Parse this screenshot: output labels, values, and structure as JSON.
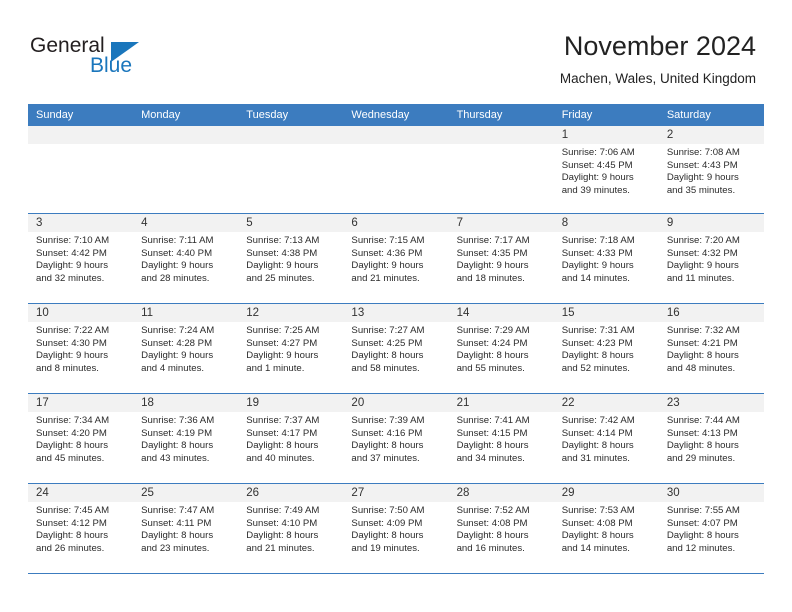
{
  "logo": {
    "word_top": "General",
    "word_bottom": "Blue",
    "accent_color": "#1a76bc"
  },
  "header": {
    "title": "November 2024",
    "subtitle": "Machen, Wales, United Kingdom"
  },
  "calendar": {
    "header_bg": "#3c7cbf",
    "daynum_bg": "#f2f2f2",
    "weekdays": [
      "Sunday",
      "Monday",
      "Tuesday",
      "Wednesday",
      "Thursday",
      "Friday",
      "Saturday"
    ],
    "weeks": [
      [
        {
          "day": "",
          "blank": true,
          "sunrise": "",
          "sunset": "",
          "daylight_1": "",
          "daylight_2": ""
        },
        {
          "day": "",
          "blank": true,
          "sunrise": "",
          "sunset": "",
          "daylight_1": "",
          "daylight_2": ""
        },
        {
          "day": "",
          "blank": true,
          "sunrise": "",
          "sunset": "",
          "daylight_1": "",
          "daylight_2": ""
        },
        {
          "day": "",
          "blank": true,
          "sunrise": "",
          "sunset": "",
          "daylight_1": "",
          "daylight_2": ""
        },
        {
          "day": "",
          "blank": true,
          "sunrise": "",
          "sunset": "",
          "daylight_1": "",
          "daylight_2": ""
        },
        {
          "day": "1",
          "sunrise": "Sunrise: 7:06 AM",
          "sunset": "Sunset: 4:45 PM",
          "daylight_1": "Daylight: 9 hours",
          "daylight_2": "and 39 minutes."
        },
        {
          "day": "2",
          "sunrise": "Sunrise: 7:08 AM",
          "sunset": "Sunset: 4:43 PM",
          "daylight_1": "Daylight: 9 hours",
          "daylight_2": "and 35 minutes."
        }
      ],
      [
        {
          "day": "3",
          "sunrise": "Sunrise: 7:10 AM",
          "sunset": "Sunset: 4:42 PM",
          "daylight_1": "Daylight: 9 hours",
          "daylight_2": "and 32 minutes."
        },
        {
          "day": "4",
          "sunrise": "Sunrise: 7:11 AM",
          "sunset": "Sunset: 4:40 PM",
          "daylight_1": "Daylight: 9 hours",
          "daylight_2": "and 28 minutes."
        },
        {
          "day": "5",
          "sunrise": "Sunrise: 7:13 AM",
          "sunset": "Sunset: 4:38 PM",
          "daylight_1": "Daylight: 9 hours",
          "daylight_2": "and 25 minutes."
        },
        {
          "day": "6",
          "sunrise": "Sunrise: 7:15 AM",
          "sunset": "Sunset: 4:36 PM",
          "daylight_1": "Daylight: 9 hours",
          "daylight_2": "and 21 minutes."
        },
        {
          "day": "7",
          "sunrise": "Sunrise: 7:17 AM",
          "sunset": "Sunset: 4:35 PM",
          "daylight_1": "Daylight: 9 hours",
          "daylight_2": "and 18 minutes."
        },
        {
          "day": "8",
          "sunrise": "Sunrise: 7:18 AM",
          "sunset": "Sunset: 4:33 PM",
          "daylight_1": "Daylight: 9 hours",
          "daylight_2": "and 14 minutes."
        },
        {
          "day": "9",
          "sunrise": "Sunrise: 7:20 AM",
          "sunset": "Sunset: 4:32 PM",
          "daylight_1": "Daylight: 9 hours",
          "daylight_2": "and 11 minutes."
        }
      ],
      [
        {
          "day": "10",
          "sunrise": "Sunrise: 7:22 AM",
          "sunset": "Sunset: 4:30 PM",
          "daylight_1": "Daylight: 9 hours",
          "daylight_2": "and 8 minutes."
        },
        {
          "day": "11",
          "sunrise": "Sunrise: 7:24 AM",
          "sunset": "Sunset: 4:28 PM",
          "daylight_1": "Daylight: 9 hours",
          "daylight_2": "and 4 minutes."
        },
        {
          "day": "12",
          "sunrise": "Sunrise: 7:25 AM",
          "sunset": "Sunset: 4:27 PM",
          "daylight_1": "Daylight: 9 hours",
          "daylight_2": "and 1 minute."
        },
        {
          "day": "13",
          "sunrise": "Sunrise: 7:27 AM",
          "sunset": "Sunset: 4:25 PM",
          "daylight_1": "Daylight: 8 hours",
          "daylight_2": "and 58 minutes."
        },
        {
          "day": "14",
          "sunrise": "Sunrise: 7:29 AM",
          "sunset": "Sunset: 4:24 PM",
          "daylight_1": "Daylight: 8 hours",
          "daylight_2": "and 55 minutes."
        },
        {
          "day": "15",
          "sunrise": "Sunrise: 7:31 AM",
          "sunset": "Sunset: 4:23 PM",
          "daylight_1": "Daylight: 8 hours",
          "daylight_2": "and 52 minutes."
        },
        {
          "day": "16",
          "sunrise": "Sunrise: 7:32 AM",
          "sunset": "Sunset: 4:21 PM",
          "daylight_1": "Daylight: 8 hours",
          "daylight_2": "and 48 minutes."
        }
      ],
      [
        {
          "day": "17",
          "sunrise": "Sunrise: 7:34 AM",
          "sunset": "Sunset: 4:20 PM",
          "daylight_1": "Daylight: 8 hours",
          "daylight_2": "and 45 minutes."
        },
        {
          "day": "18",
          "sunrise": "Sunrise: 7:36 AM",
          "sunset": "Sunset: 4:19 PM",
          "daylight_1": "Daylight: 8 hours",
          "daylight_2": "and 43 minutes."
        },
        {
          "day": "19",
          "sunrise": "Sunrise: 7:37 AM",
          "sunset": "Sunset: 4:17 PM",
          "daylight_1": "Daylight: 8 hours",
          "daylight_2": "and 40 minutes."
        },
        {
          "day": "20",
          "sunrise": "Sunrise: 7:39 AM",
          "sunset": "Sunset: 4:16 PM",
          "daylight_1": "Daylight: 8 hours",
          "daylight_2": "and 37 minutes."
        },
        {
          "day": "21",
          "sunrise": "Sunrise: 7:41 AM",
          "sunset": "Sunset: 4:15 PM",
          "daylight_1": "Daylight: 8 hours",
          "daylight_2": "and 34 minutes."
        },
        {
          "day": "22",
          "sunrise": "Sunrise: 7:42 AM",
          "sunset": "Sunset: 4:14 PM",
          "daylight_1": "Daylight: 8 hours",
          "daylight_2": "and 31 minutes."
        },
        {
          "day": "23",
          "sunrise": "Sunrise: 7:44 AM",
          "sunset": "Sunset: 4:13 PM",
          "daylight_1": "Daylight: 8 hours",
          "daylight_2": "and 29 minutes."
        }
      ],
      [
        {
          "day": "24",
          "sunrise": "Sunrise: 7:45 AM",
          "sunset": "Sunset: 4:12 PM",
          "daylight_1": "Daylight: 8 hours",
          "daylight_2": "and 26 minutes."
        },
        {
          "day": "25",
          "sunrise": "Sunrise: 7:47 AM",
          "sunset": "Sunset: 4:11 PM",
          "daylight_1": "Daylight: 8 hours",
          "daylight_2": "and 23 minutes."
        },
        {
          "day": "26",
          "sunrise": "Sunrise: 7:49 AM",
          "sunset": "Sunset: 4:10 PM",
          "daylight_1": "Daylight: 8 hours",
          "daylight_2": "and 21 minutes."
        },
        {
          "day": "27",
          "sunrise": "Sunrise: 7:50 AM",
          "sunset": "Sunset: 4:09 PM",
          "daylight_1": "Daylight: 8 hours",
          "daylight_2": "and 19 minutes."
        },
        {
          "day": "28",
          "sunrise": "Sunrise: 7:52 AM",
          "sunset": "Sunset: 4:08 PM",
          "daylight_1": "Daylight: 8 hours",
          "daylight_2": "and 16 minutes."
        },
        {
          "day": "29",
          "sunrise": "Sunrise: 7:53 AM",
          "sunset": "Sunset: 4:08 PM",
          "daylight_1": "Daylight: 8 hours",
          "daylight_2": "and 14 minutes."
        },
        {
          "day": "30",
          "sunrise": "Sunrise: 7:55 AM",
          "sunset": "Sunset: 4:07 PM",
          "daylight_1": "Daylight: 8 hours",
          "daylight_2": "and 12 minutes."
        }
      ]
    ]
  }
}
